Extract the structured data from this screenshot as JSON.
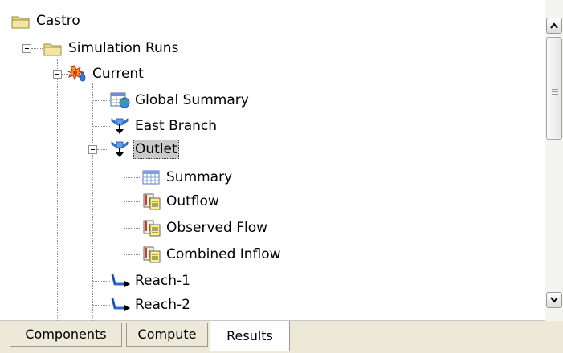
{
  "tree": {
    "root": {
      "label": "Castro",
      "icon": "folder-icon"
    },
    "simulation_runs": {
      "label": "Simulation Runs",
      "icon": "folder-icon"
    },
    "current": {
      "label": "Current",
      "icon": "current-run-icon"
    },
    "global_summary": {
      "label": "Global Summary",
      "icon": "global-summary-icon"
    },
    "east_branch": {
      "label": "East Branch",
      "icon": "junction-icon"
    },
    "outlet": {
      "label": "Outlet",
      "icon": "junction-icon",
      "selected": true
    },
    "summary": {
      "label": "Summary",
      "icon": "table-icon"
    },
    "outflow": {
      "label": "Outflow",
      "icon": "graph-icon"
    },
    "observed_flow": {
      "label": "Observed Flow",
      "icon": "graph-icon"
    },
    "combined_inflow": {
      "label": "Combined Inflow",
      "icon": "graph-icon"
    },
    "reach_1": {
      "label": "Reach-1",
      "icon": "reach-icon"
    },
    "reach_2": {
      "label": "Reach-2",
      "icon": "reach-icon"
    }
  },
  "tabs": [
    {
      "label": "Components",
      "active": false
    },
    {
      "label": "Compute",
      "active": false
    },
    {
      "label": "Results",
      "active": true
    }
  ],
  "colors": {
    "selection": "#c9c9c9",
    "tab_bg": "#ece9d8"
  }
}
